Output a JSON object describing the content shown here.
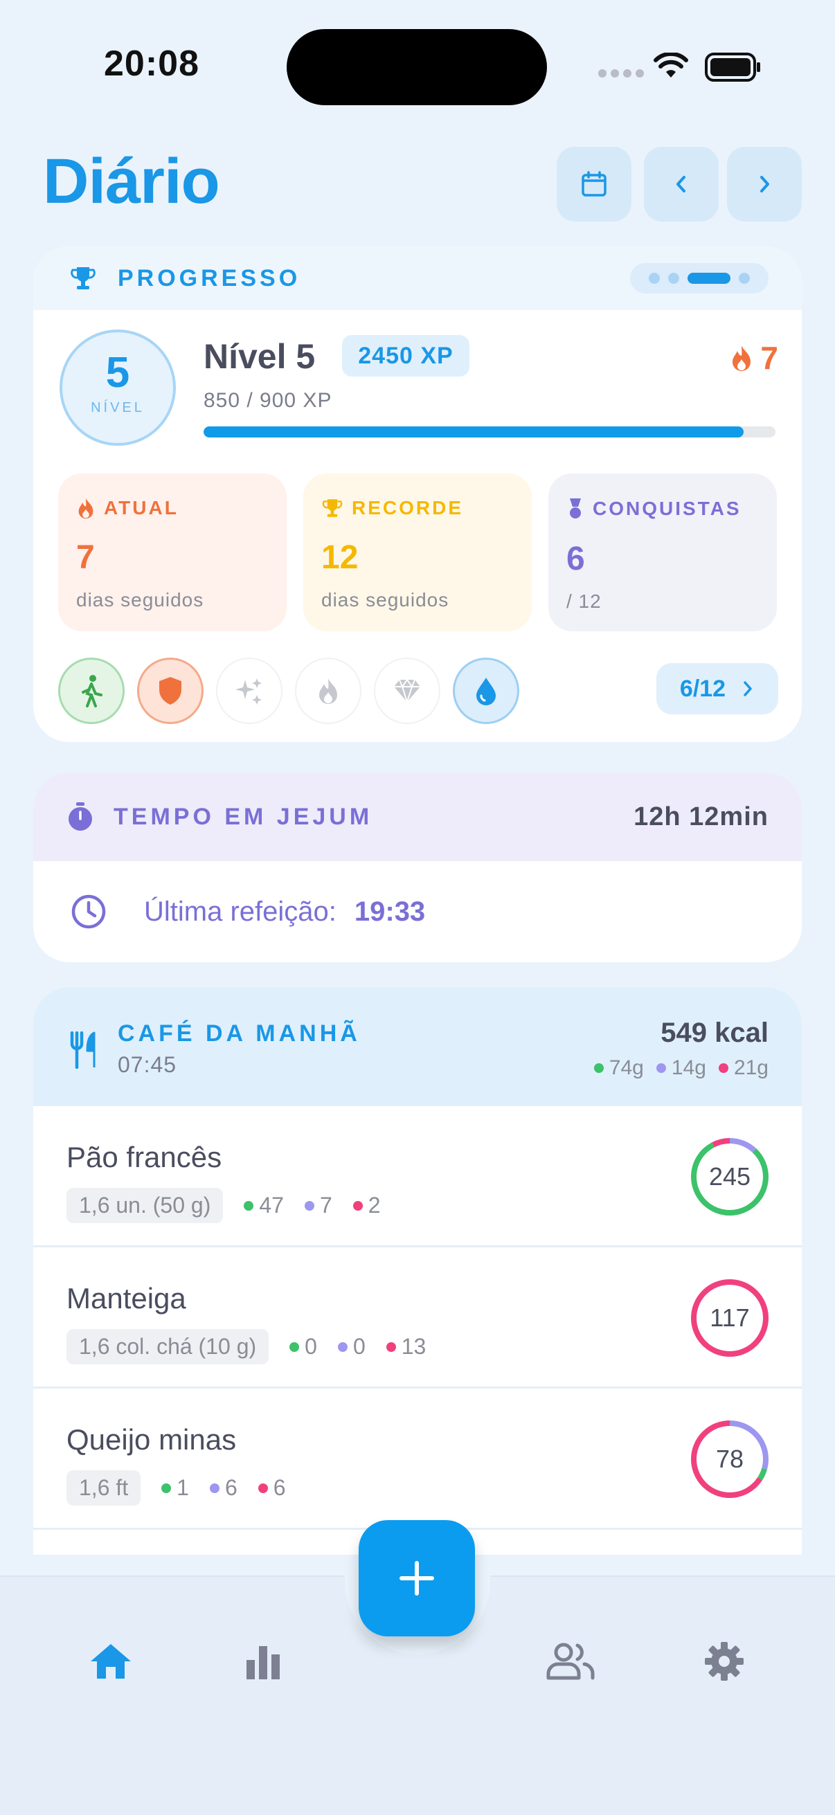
{
  "status_bar": {
    "time": "20:08"
  },
  "header": {
    "title": "Diário"
  },
  "progress": {
    "section_label": "PROGRESSO",
    "level_number": "5",
    "level_caption": "NÍVEL",
    "level_title": "Nível 5",
    "xp_badge": "2450 XP",
    "xp_text": "850 / 900 XP",
    "xp_fraction": 0.944,
    "streak": "7",
    "stats": [
      {
        "label": "ATUAL",
        "value": "7",
        "sub": "dias seguidos",
        "color": "#f0713c"
      },
      {
        "label": "RECORDE",
        "value": "12",
        "sub": "dias seguidos",
        "color": "#f5b800"
      },
      {
        "label": "CONQUISTAS",
        "value": "6",
        "sub": "/ 12",
        "color": "#7a6fd6"
      }
    ],
    "achievements_count": "6/12"
  },
  "fasting": {
    "label": "TEMPO EM JEJUM",
    "duration": "12h 12min",
    "last_meal_label": "Última refeição:",
    "last_meal_time": "19:33"
  },
  "meal": {
    "name": "CAFÉ DA MANHÃ",
    "time": "07:45",
    "kcal": "549 kcal",
    "macros": {
      "carbs": "74g",
      "protein": "14g",
      "fat": "21g"
    },
    "items": [
      {
        "name": "Pão francês",
        "portion": "1,6 un. (50 g)",
        "carbs": "47",
        "protein": "7",
        "fat": "2",
        "kcal": "245"
      },
      {
        "name": "Manteiga",
        "portion": "1,6 col. chá (10 g)",
        "carbs": "0",
        "protein": "0",
        "fat": "13",
        "kcal": "117"
      },
      {
        "name": "Queijo minas",
        "portion": "1,6 ft",
        "carbs": "1",
        "protein": "6",
        "fat": "6",
        "kcal": "78"
      }
    ]
  },
  "colors": {
    "accent": "#1a97e6",
    "carbs": "#3cc26a",
    "protein": "#9d97ef",
    "fat": "#f0407e"
  },
  "nav": {
    "fab_icon": "plus-icon"
  }
}
